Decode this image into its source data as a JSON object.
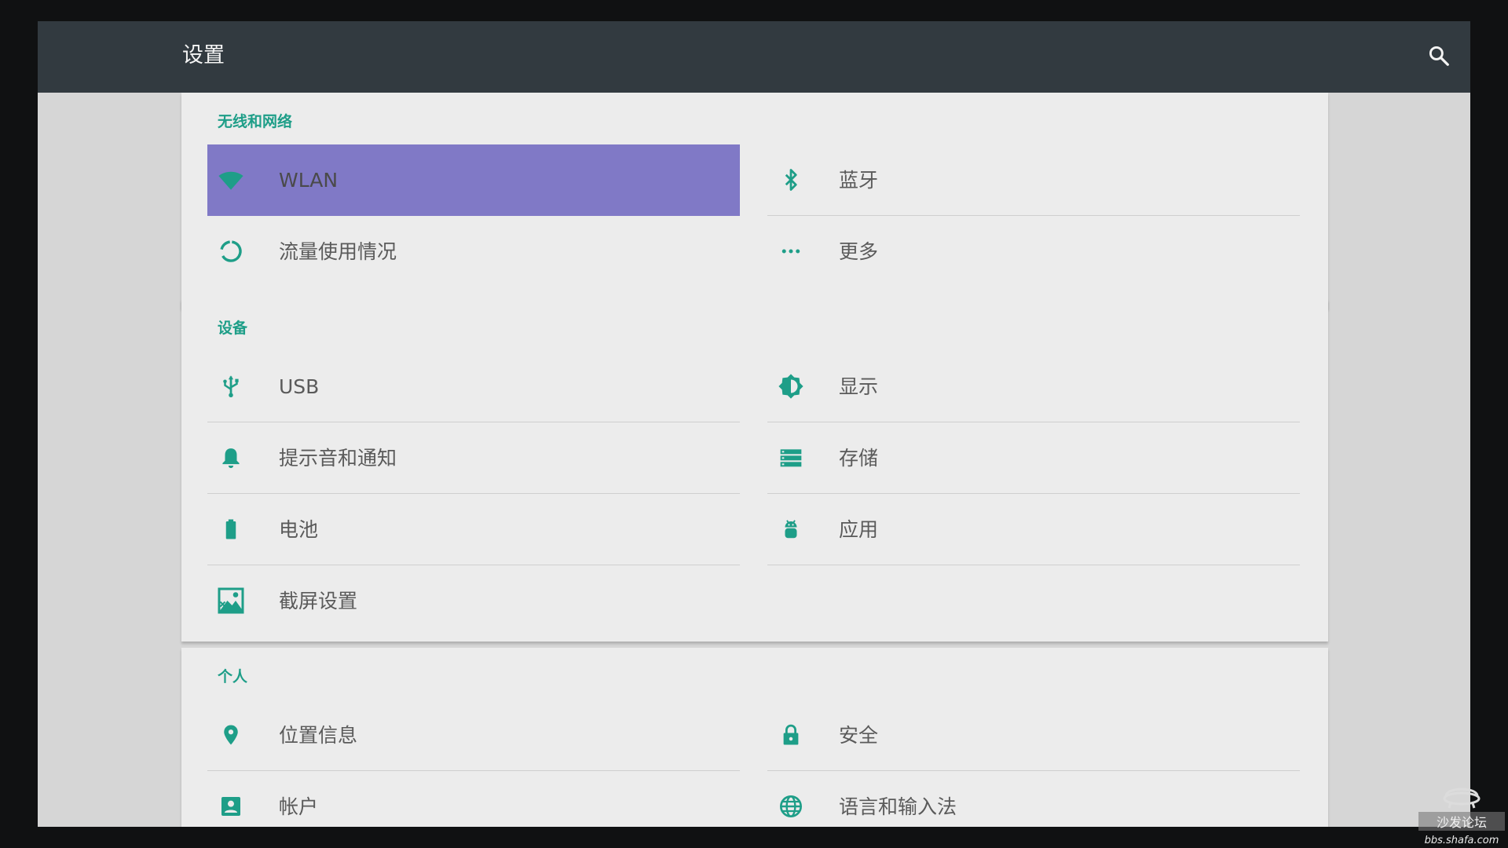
{
  "header": {
    "title": "设置"
  },
  "colors": {
    "accent": "#1e9e88",
    "appbar": "#323a40",
    "selected": "#8079c6",
    "card": "#ececec"
  },
  "sections": [
    {
      "title": "无线和网络",
      "items": [
        {
          "label": "WLAN",
          "icon": "wifi-icon",
          "selected": true
        },
        {
          "label": "蓝牙",
          "icon": "bluetooth-icon"
        },
        {
          "label": "流量使用情况",
          "icon": "data-usage-icon"
        },
        {
          "label": "更多",
          "icon": "more-icon"
        }
      ]
    },
    {
      "title": "设备",
      "items": [
        {
          "label": "USB",
          "icon": "usb-icon"
        },
        {
          "label": "显示",
          "icon": "brightness-icon"
        },
        {
          "label": "提示音和通知",
          "icon": "bell-icon"
        },
        {
          "label": "存储",
          "icon": "storage-icon"
        },
        {
          "label": "电池",
          "icon": "battery-icon"
        },
        {
          "label": "应用",
          "icon": "android-icon"
        },
        {
          "label": "截屏设置",
          "icon": "screenshot-icon"
        }
      ]
    },
    {
      "title": "个人",
      "items": [
        {
          "label": "位置信息",
          "icon": "location-icon"
        },
        {
          "label": "安全",
          "icon": "lock-icon"
        },
        {
          "label": "帐户",
          "icon": "account-icon"
        },
        {
          "label": "语言和输入法",
          "icon": "globe-icon"
        }
      ]
    }
  ],
  "watermark": {
    "text": "沙发论坛",
    "url": "bbs.shafa.com",
    "icon": "sofa-logo-icon"
  }
}
